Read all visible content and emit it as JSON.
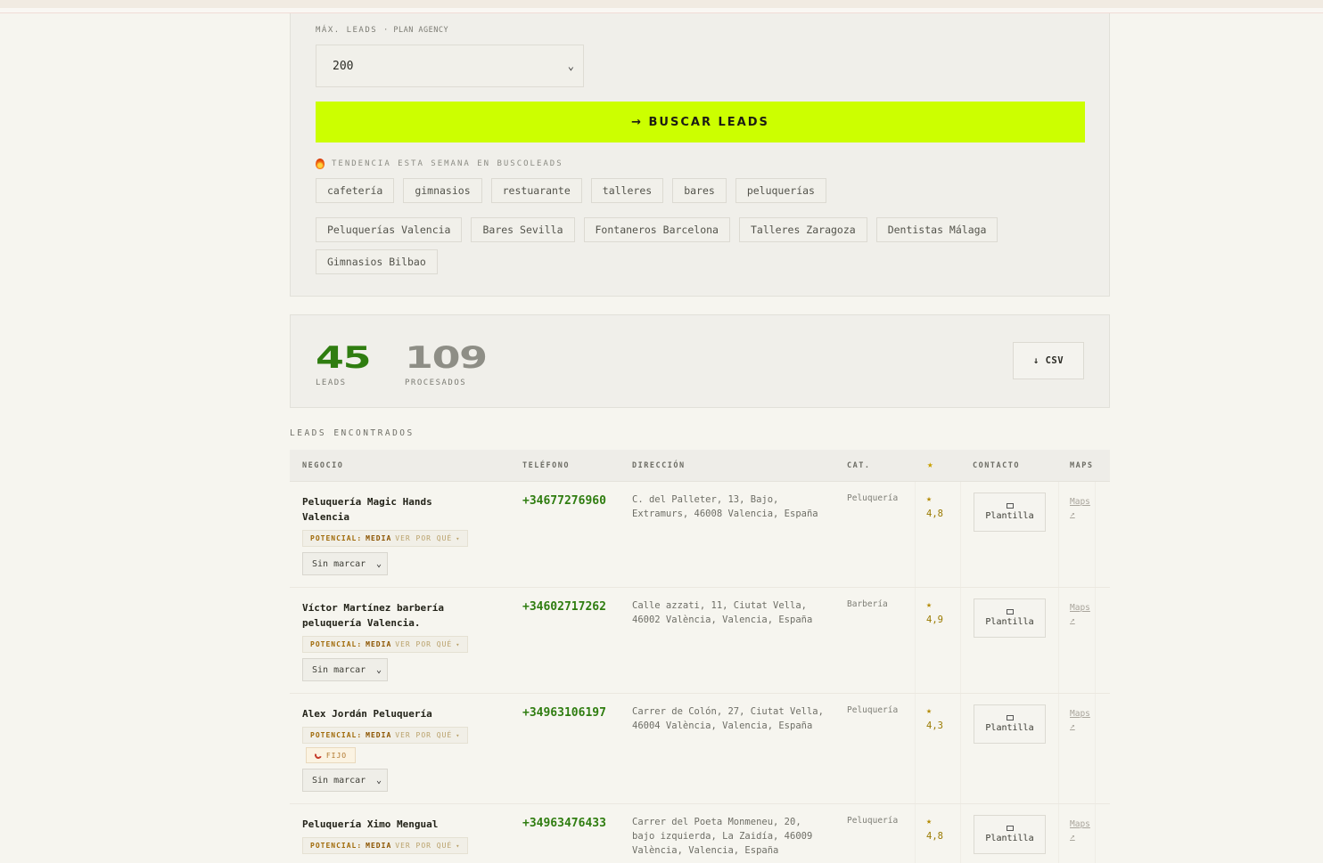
{
  "form": {
    "max_label": "MÁX. LEADS",
    "plan_label": "· PLAN AGENCY",
    "max_value": "200",
    "search_button": "→ BUSCAR LEADS"
  },
  "trending": {
    "title": "TENDENCIA ESTA SEMANA EN BUSCOLEADS",
    "row1": [
      "cafetería",
      "gimnasios",
      "restuarante",
      "talleres",
      "bares",
      "peluquerías"
    ],
    "row2": [
      "Peluquerías Valencia",
      "Bares Sevilla",
      "Fontaneros Barcelona",
      "Talleres Zaragoza",
      "Dentistas Málaga"
    ],
    "row3": [
      "Gimnasios Bilbao"
    ]
  },
  "stats": {
    "leads_value": "45",
    "leads_label": "LEADS",
    "processed_value": "109",
    "processed_label": "PROCESADOS",
    "csv_button": "↓ CSV"
  },
  "results": {
    "title": "LEADS ENCONTRADOS",
    "columns": {
      "negocio": "NEGOCIO",
      "telefono": "TELÉFONO",
      "direccion": "DIRECCIÓN",
      "cat": "CAT.",
      "star": "★",
      "contacto": "CONTACTO",
      "maps": "MAPS"
    },
    "potential_prefix": "POTENCIAL:",
    "potential_level": "MEDIA",
    "why_label": "VER POR QUÉ",
    "why_chevron": "▾",
    "mark_default": "Sin marcar",
    "fijo_label": "FIJO",
    "template_label": "Plantilla",
    "maps_label": "Maps",
    "maps_arrow": "↗",
    "rows": [
      {
        "name": "Peluquería Magic Hands Valencia",
        "phone": "+34677276960",
        "address": "C. del Palleter, 13, Bajo, Extramurs, 46008 Valencia, España",
        "category": "Peluquería",
        "rating": "4,8"
      },
      {
        "name": "Víctor Martínez barbería peluquería Valencia.",
        "phone": "+34602717262",
        "address": "Calle azzati, 11, Ciutat Vella, 46002 València, Valencia, España",
        "category": "Barbería",
        "rating": "4,9"
      },
      {
        "name": "Alex Jordán Peluquería",
        "phone": "+34963106197",
        "address": "Carrer de Colón, 27, Ciutat Vella, 46004 València, Valencia, España",
        "category": "Peluquería",
        "rating": "4,3"
      },
      {
        "name": "Peluquería Ximo Mengual",
        "phone": "+34963476433",
        "address": "Carrer del Poeta Monmeneu, 20, bajo izquierda, La Zaidía, 46009 València, Valencia, España",
        "category": "Peluquería",
        "rating": "4,8"
      }
    ]
  }
}
